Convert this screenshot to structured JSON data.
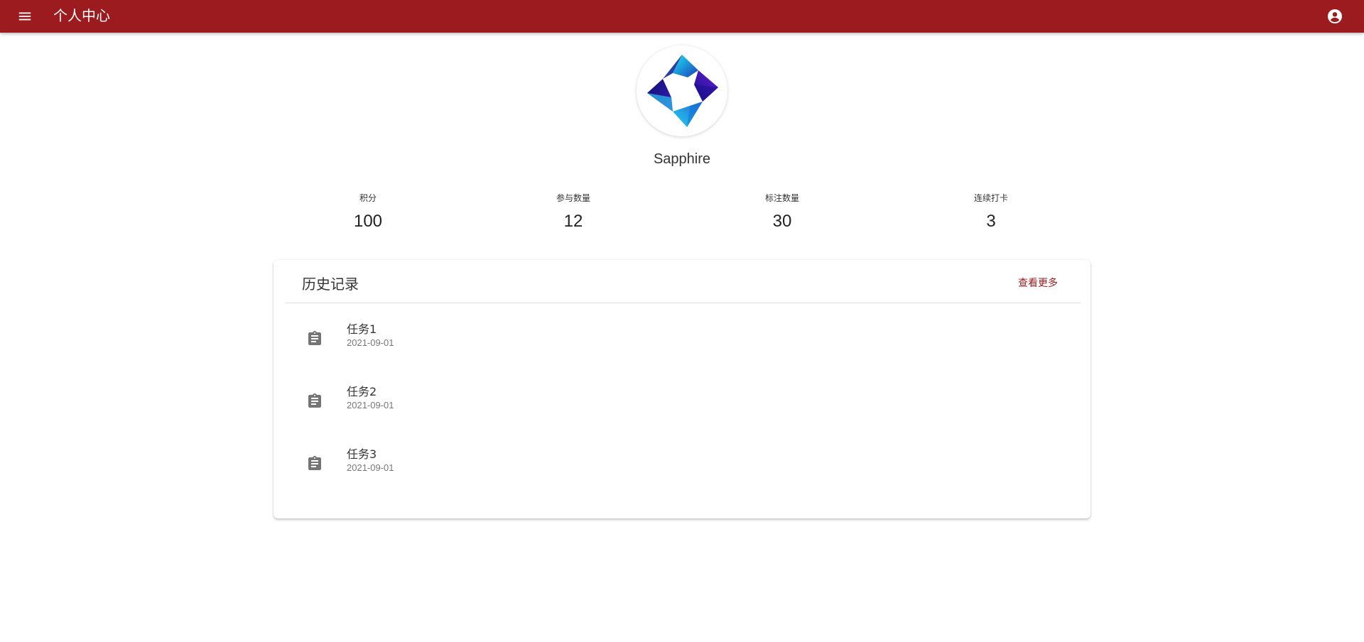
{
  "header": {
    "title": "个人中心",
    "menu_icon": "menu-icon",
    "account_icon": "account-circle-icon"
  },
  "profile": {
    "username": "Sapphire",
    "avatar": "sapphire-logo"
  },
  "stats": [
    {
      "label": "积分",
      "value": "100"
    },
    {
      "label": "参与数量",
      "value": "12"
    },
    {
      "label": "标注数量",
      "value": "30"
    },
    {
      "label": "连续打卡",
      "value": "3"
    }
  ],
  "history": {
    "title": "历史记录",
    "more_label": "查看更多",
    "items": [
      {
        "name": "任务1",
        "date": "2021-09-01",
        "icon": "clipboard-icon"
      },
      {
        "name": "任务2",
        "date": "2021-09-01",
        "icon": "clipboard-icon"
      },
      {
        "name": "任务3",
        "date": "2021-09-01",
        "icon": "clipboard-icon"
      }
    ]
  },
  "colors": {
    "primary": "#9b1b1e",
    "icon_gray": "#757575"
  }
}
